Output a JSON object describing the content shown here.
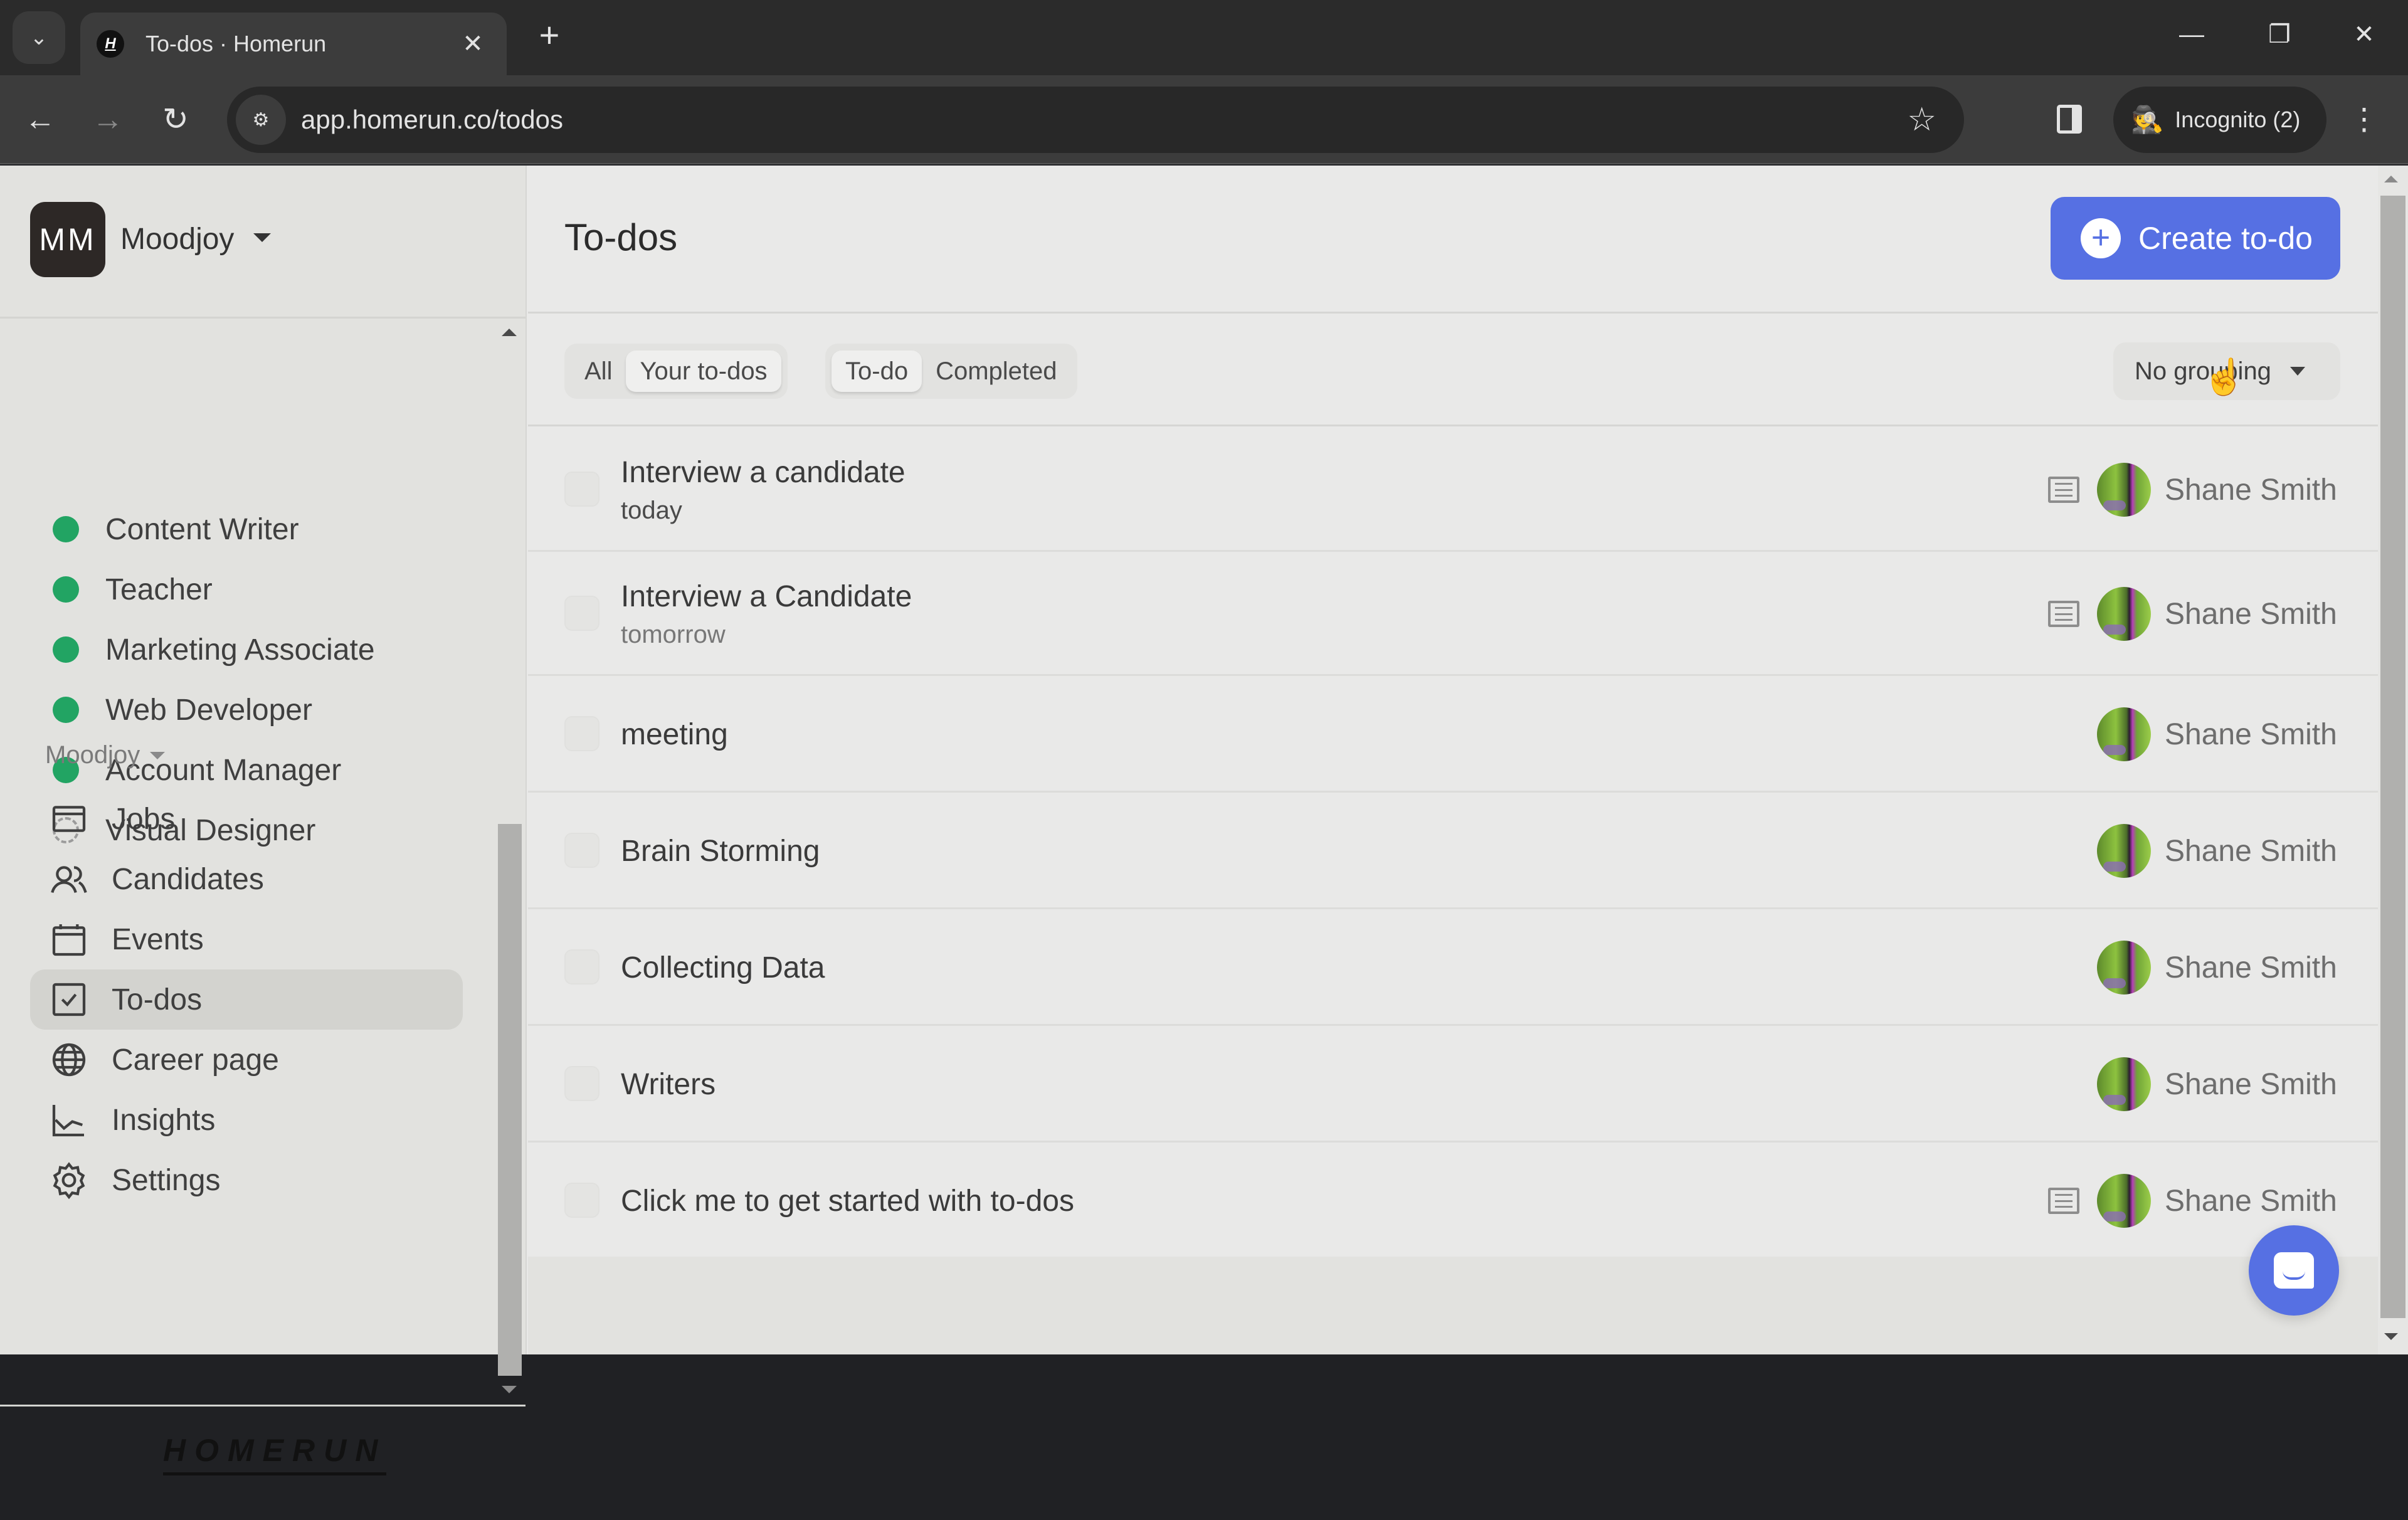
{
  "browser": {
    "tab_title": "To-dos · Homerun",
    "tab_favicon_letter": "H",
    "url": "app.homerun.co/todos",
    "incognito_label": "Incognito (2)",
    "icons": {
      "tab_search": "⌄",
      "tab_close": "✕",
      "new_tab": "+",
      "minimize": "—",
      "restore": "❐",
      "close": "✕",
      "back": "←",
      "forward": "→",
      "reload": "↻",
      "site_info": "⚙",
      "star": "☆",
      "incognito": "🕵",
      "menu": "⋮"
    }
  },
  "sidebar": {
    "org_initials": "MM",
    "org_name": "Moodjoy",
    "jobs": [
      {
        "label": "Content Writer",
        "status": "published"
      },
      {
        "label": "Teacher",
        "status": "published"
      },
      {
        "label": "Marketing Associate",
        "status": "published"
      },
      {
        "label": "Web Developer",
        "status": "published"
      },
      {
        "label": "Account Manager",
        "status": "published"
      },
      {
        "label": "Visual Designer",
        "status": "draft"
      }
    ],
    "section_label": "Moodjoy",
    "nav": [
      {
        "label": "Jobs",
        "icon": "jobs-icon"
      },
      {
        "label": "Candidates",
        "icon": "candidates-icon"
      },
      {
        "label": "Events",
        "icon": "calendar-icon"
      },
      {
        "label": "To-dos",
        "icon": "todo-check-icon",
        "active": true
      },
      {
        "label": "Career page",
        "icon": "globe-icon"
      },
      {
        "label": "Insights",
        "icon": "chart-icon"
      },
      {
        "label": "Settings",
        "icon": "gear-icon"
      }
    ],
    "logo": "HOMERUN"
  },
  "main": {
    "title": "To-dos",
    "create_button": "Create to-do",
    "filters": {
      "scope": [
        {
          "label": "All",
          "selected": false
        },
        {
          "label": "Your to-dos",
          "selected": true
        }
      ],
      "status": [
        {
          "label": "To-do",
          "selected": true
        },
        {
          "label": "Completed",
          "selected": false
        }
      ]
    },
    "grouping": "No grouping",
    "todos": [
      {
        "title": "Interview a candidate",
        "due": "today",
        "has_note": true,
        "assignee": "Shane Smith"
      },
      {
        "title": "Interview a Candidate",
        "due": "tomorrow",
        "has_note": true,
        "assignee": "Shane Smith"
      },
      {
        "title": "meeting",
        "due": "",
        "has_note": false,
        "assignee": "Shane Smith"
      },
      {
        "title": "Brain Storming",
        "due": "",
        "has_note": false,
        "assignee": "Shane Smith"
      },
      {
        "title": "Collecting Data",
        "due": "",
        "has_note": false,
        "assignee": "Shane Smith"
      },
      {
        "title": "Writers",
        "due": "",
        "has_note": false,
        "assignee": "Shane Smith"
      },
      {
        "title": "Click me to get started with to-dos",
        "due": "",
        "has_note": true,
        "assignee": "Shane Smith"
      }
    ]
  },
  "colors": {
    "accent": "#5670e3",
    "published_dot": "#22a463",
    "sidebar_bg": "#e2e2df",
    "main_bg": "#e9e9e8"
  }
}
